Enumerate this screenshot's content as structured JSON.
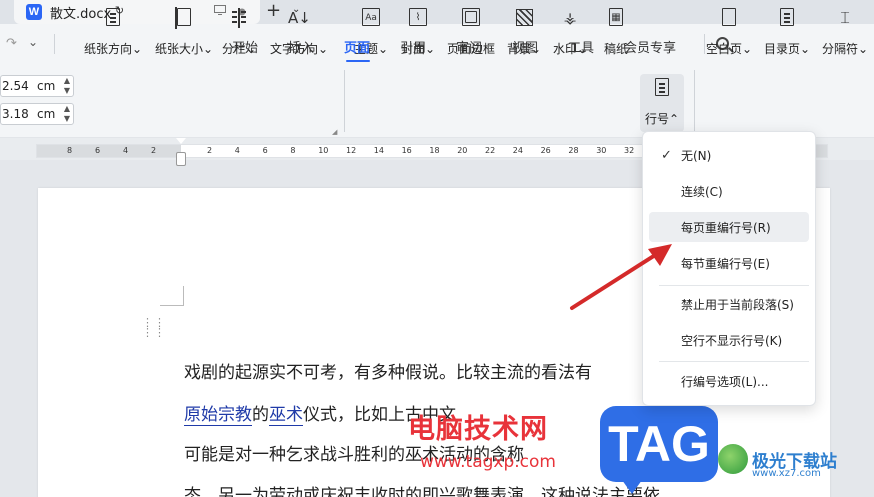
{
  "titlebar": {
    "doc_icon": "W",
    "doc_name": "散文.docx",
    "add_tab": "+",
    "caret": "⌄"
  },
  "menu": {
    "tabs": [
      "开始",
      "插入",
      "页面",
      "引用",
      "审阅",
      "视图",
      "工具",
      "会员专享"
    ],
    "active_index": 2
  },
  "margins": {
    "top_value": "2.54",
    "bottom_value": "3.18",
    "unit": "cm"
  },
  "toolbar": {
    "tools": [
      {
        "label": "纸张方向",
        "icon": "paper-orientation-icon"
      },
      {
        "label": "纸张大小",
        "icon": "paper-size-icon"
      },
      {
        "label": "分栏",
        "icon": "columns-icon"
      },
      {
        "label": "文字方向",
        "icon": "text-direction-icon"
      },
      {
        "label": "主题",
        "icon": "theme-icon"
      },
      {
        "label": "封面",
        "icon": "cover-icon"
      },
      {
        "label": "页面边框",
        "icon": "page-border-icon"
      },
      {
        "label": "背景",
        "icon": "background-icon"
      },
      {
        "label": "水印",
        "icon": "watermark-icon"
      },
      {
        "label": "稿纸",
        "icon": "manuscript-icon"
      },
      {
        "label": "行号",
        "icon": "line-number-icon"
      },
      {
        "label": "空白页",
        "icon": "blank-page-icon"
      },
      {
        "label": "目录页",
        "icon": "toc-page-icon"
      },
      {
        "label": "分隔符",
        "icon": "separator-icon"
      }
    ],
    "dropdown_caret": "⌄",
    "active_caret": "⌃"
  },
  "ruler": {
    "left_numbers": [
      "8",
      "6",
      "4",
      "2"
    ],
    "right_numbers": [
      "2",
      "4",
      "6",
      "8",
      "10",
      "12",
      "14",
      "16",
      "18",
      "20",
      "22",
      "24",
      "26",
      "28",
      "30",
      "32"
    ]
  },
  "document": {
    "line1": "戏剧的起源实不可考，有多种假说。比较主流的看法有",
    "line2_link1": "原始宗教",
    "line2_mid": "的",
    "line2_link2": "巫术",
    "line2_rest": "仪式，比如上古中文",
    "line3": "可能是对一种乞求战斗胜利的巫术活动的含称",
    "line4": "态。另一为劳动或庆祝丰收时的即兴歌舞表演，这种说法主要依"
  },
  "dropdown": {
    "items": [
      {
        "label": "无(N)",
        "checked": true
      },
      {
        "label": "连续(C)",
        "checked": false
      },
      {
        "label": "每页重编行号(R)",
        "checked": false,
        "highlighted": true
      },
      {
        "label": "每节重编行号(E)",
        "checked": false
      },
      {
        "label": "禁止用于当前段落(S)",
        "checked": false
      },
      {
        "label": "空行不显示行号(K)",
        "checked": false
      },
      {
        "label": "行编号选项(L)...",
        "checked": false
      }
    ],
    "check_glyph": "✓"
  },
  "watermark": {
    "site_name": "电脑技术网",
    "url": "www.tagxp.com",
    "tag": "TAG",
    "brand": "极光下载站",
    "brand_url": "www.xz7.com"
  },
  "colors": {
    "accent": "#2b66f5",
    "arrow": "#d42a2a",
    "watermark_red": "#e8333a"
  }
}
